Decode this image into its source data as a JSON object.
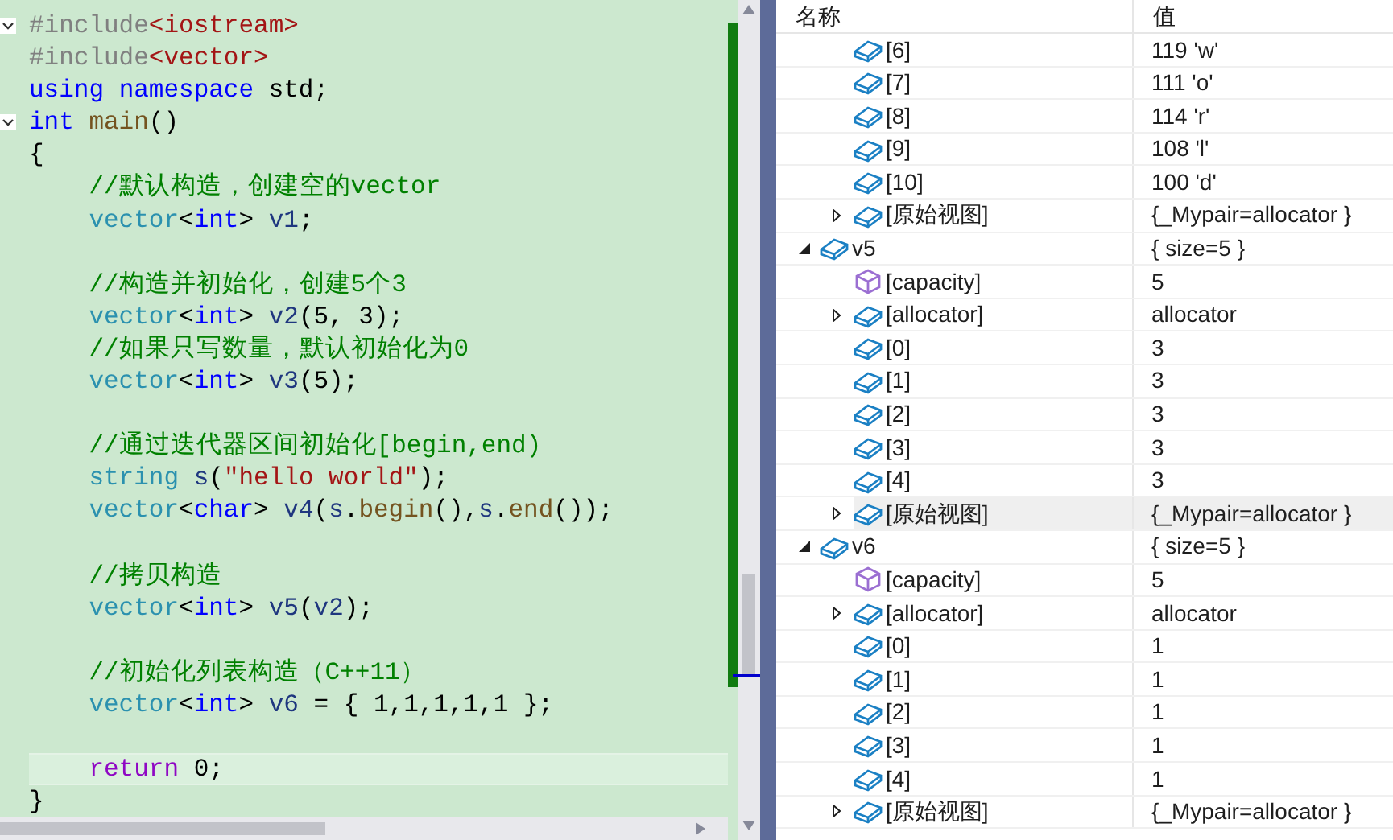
{
  "editor": {
    "lines": [
      {
        "expanded": true,
        "current": false,
        "tokens": [
          {
            "kind": "pre",
            "text": "#include"
          },
          {
            "kind": "inc",
            "text": "<iostream>"
          }
        ]
      },
      {
        "current": false,
        "tokens": [
          {
            "kind": "pre",
            "text": "#include"
          },
          {
            "kind": "inc",
            "text": "<vector>"
          }
        ]
      },
      {
        "current": false,
        "tokens": [
          {
            "kind": "kw",
            "text": "using"
          },
          {
            "kind": "kw",
            "text": " namespace"
          },
          {
            "kind": "plain",
            "text": " std;"
          }
        ]
      },
      {
        "expanded": true,
        "current": false,
        "tokens": [
          {
            "kind": "kw",
            "text": "int"
          },
          {
            "kind": "fn",
            "text": " main"
          },
          {
            "kind": "plain",
            "text": "()"
          }
        ]
      },
      {
        "current": false,
        "tokens": [
          {
            "kind": "plain",
            "text": "{"
          }
        ]
      },
      {
        "current": false,
        "tokens": [
          {
            "kind": "comment",
            "text": "    //默认构造，创建空的vector"
          }
        ]
      },
      {
        "current": false,
        "tokens": [
          {
            "kind": "type",
            "text": "    vector"
          },
          {
            "kind": "plain",
            "text": "<"
          },
          {
            "kind": "kw",
            "text": "int"
          },
          {
            "kind": "plain",
            "text": ">"
          },
          {
            "kind": "var",
            "text": " v1"
          },
          {
            "kind": "plain",
            "text": ";"
          }
        ]
      },
      {
        "current": false
      },
      {
        "current": false,
        "tokens": [
          {
            "kind": "comment",
            "text": "    //构造并初始化，创建5个3"
          }
        ]
      },
      {
        "current": false,
        "tokens": [
          {
            "kind": "type",
            "text": "    vector"
          },
          {
            "kind": "plain",
            "text": "<"
          },
          {
            "kind": "kw",
            "text": "int"
          },
          {
            "kind": "plain",
            "text": ">"
          },
          {
            "kind": "var",
            "text": " v2"
          },
          {
            "kind": "plain",
            "text": "(5, 3);"
          }
        ]
      },
      {
        "current": false,
        "tokens": [
          {
            "kind": "comment",
            "text": "    //如果只写数量，默认初始化为0"
          }
        ]
      },
      {
        "current": false,
        "tokens": [
          {
            "kind": "type",
            "text": "    vector"
          },
          {
            "kind": "plain",
            "text": "<"
          },
          {
            "kind": "kw",
            "text": "int"
          },
          {
            "kind": "plain",
            "text": ">"
          },
          {
            "kind": "var",
            "text": " v3"
          },
          {
            "kind": "plain",
            "text": "(5);"
          }
        ]
      },
      {
        "current": false
      },
      {
        "current": false,
        "tokens": [
          {
            "kind": "comment",
            "text": "    //通过迭代器区间初始化[begin,end)"
          }
        ]
      },
      {
        "current": false,
        "tokens": [
          {
            "kind": "type",
            "text": "    string"
          },
          {
            "kind": "var",
            "text": " s"
          },
          {
            "kind": "plain",
            "text": "("
          },
          {
            "kind": "str",
            "text": "\"hello world\""
          },
          {
            "kind": "plain",
            "text": ");"
          }
        ]
      },
      {
        "current": false,
        "tokens": [
          {
            "kind": "type",
            "text": "    vector"
          },
          {
            "kind": "plain",
            "text": "<"
          },
          {
            "kind": "kw",
            "text": "char"
          },
          {
            "kind": "plain",
            "text": ">"
          },
          {
            "kind": "var",
            "text": " v4"
          },
          {
            "kind": "plain",
            "text": "("
          },
          {
            "kind": "var",
            "text": "s"
          },
          {
            "kind": "plain",
            "text": "."
          },
          {
            "kind": "fn",
            "text": "begin"
          },
          {
            "kind": "plain",
            "text": "(),"
          },
          {
            "kind": "var",
            "text": "s"
          },
          {
            "kind": "plain",
            "text": "."
          },
          {
            "kind": "fn",
            "text": "end"
          },
          {
            "kind": "plain",
            "text": "());"
          }
        ]
      },
      {
        "current": false
      },
      {
        "current": false,
        "tokens": [
          {
            "kind": "comment",
            "text": "    //拷贝构造"
          }
        ]
      },
      {
        "current": false,
        "tokens": [
          {
            "kind": "type",
            "text": "    vector"
          },
          {
            "kind": "plain",
            "text": "<"
          },
          {
            "kind": "kw",
            "text": "int"
          },
          {
            "kind": "plain",
            "text": ">"
          },
          {
            "kind": "var",
            "text": " v5"
          },
          {
            "kind": "plain",
            "text": "("
          },
          {
            "kind": "var",
            "text": "v2"
          },
          {
            "kind": "plain",
            "text": ");"
          }
        ]
      },
      {
        "current": false
      },
      {
        "current": false,
        "tokens": [
          {
            "kind": "comment",
            "text": "    //初始化列表构造（C++11）"
          }
        ]
      },
      {
        "current": false,
        "tokens": [
          {
            "kind": "type",
            "text": "    vector"
          },
          {
            "kind": "plain",
            "text": "<"
          },
          {
            "kind": "kw",
            "text": "int"
          },
          {
            "kind": "plain",
            "text": ">"
          },
          {
            "kind": "var",
            "text": " v6"
          },
          {
            "kind": "plain",
            "text": " = { 1,1,1,1,1 };"
          }
        ]
      },
      {
        "current": false
      },
      {
        "current": true,
        "tokens": [
          {
            "kind": "ctrl",
            "text": "    return"
          },
          {
            "kind": "plain",
            "text": " 0;"
          }
        ]
      },
      {
        "current": false,
        "tokens": [
          {
            "kind": "plain",
            "text": "}"
          }
        ]
      }
    ]
  },
  "watch": {
    "columns": [
      "名称",
      "值"
    ],
    "rows": [
      {
        "children": [
          {
            "kind": "field",
            "name": "[6]",
            "value": "119 'w'",
            "highlighted": false
          },
          {
            "kind": "field",
            "name": "[7]",
            "value": "111 'o'",
            "highlighted": false
          },
          {
            "kind": "field",
            "name": "[8]",
            "value": "114 'r'",
            "highlighted": false
          },
          {
            "kind": "field",
            "name": "[9]",
            "value": "108 'l'",
            "highlighted": false
          },
          {
            "kind": "field",
            "name": "[10]",
            "value": "100 'd'",
            "highlighted": false
          },
          {
            "kind": "field",
            "name": "[原始视图]",
            "value": "{_Mypair=allocator }",
            "expanded": false,
            "highlighted": false
          }
        ]
      },
      {
        "kind": "field",
        "name": "v5",
        "value": "{ size=5 }",
        "expanded": true,
        "highlighted": false,
        "children": [
          {
            "kind": "property",
            "name": "[capacity]",
            "value": "5",
            "highlighted": false
          },
          {
            "kind": "field",
            "name": "[allocator]",
            "value": "allocator",
            "expanded": false,
            "highlighted": false
          },
          {
            "kind": "field",
            "name": "[0]",
            "value": "3",
            "highlighted": false
          },
          {
            "kind": "field",
            "name": "[1]",
            "value": "3",
            "highlighted": false
          },
          {
            "kind": "field",
            "name": "[2]",
            "value": "3",
            "highlighted": false
          },
          {
            "kind": "field",
            "name": "[3]",
            "value": "3",
            "highlighted": false
          },
          {
            "kind": "field",
            "name": "[4]",
            "value": "3",
            "highlighted": false
          },
          {
            "kind": "field",
            "name": "[原始视图]",
            "value": "{_Mypair=allocator }",
            "expanded": false,
            "highlighted": true
          }
        ]
      },
      {
        "kind": "field",
        "name": "v6",
        "value": "{ size=5 }",
        "expanded": true,
        "highlighted": false,
        "children": [
          {
            "kind": "property",
            "name": "[capacity]",
            "value": "5",
            "highlighted": false
          },
          {
            "kind": "field",
            "name": "[allocator]",
            "value": "allocator",
            "expanded": false,
            "highlighted": false
          },
          {
            "kind": "field",
            "name": "[0]",
            "value": "1",
            "highlighted": false
          },
          {
            "kind": "field",
            "name": "[1]",
            "value": "1",
            "highlighted": false
          },
          {
            "kind": "field",
            "name": "[2]",
            "value": "1",
            "highlighted": false
          },
          {
            "kind": "field",
            "name": "[3]",
            "value": "1",
            "highlighted": false
          },
          {
            "kind": "field",
            "name": "[4]",
            "value": "1",
            "highlighted": false
          },
          {
            "kind": "field",
            "name": "[原始视图]",
            "value": "{_Mypair=allocator }",
            "expanded": false,
            "highlighted": false
          }
        ]
      }
    ]
  }
}
